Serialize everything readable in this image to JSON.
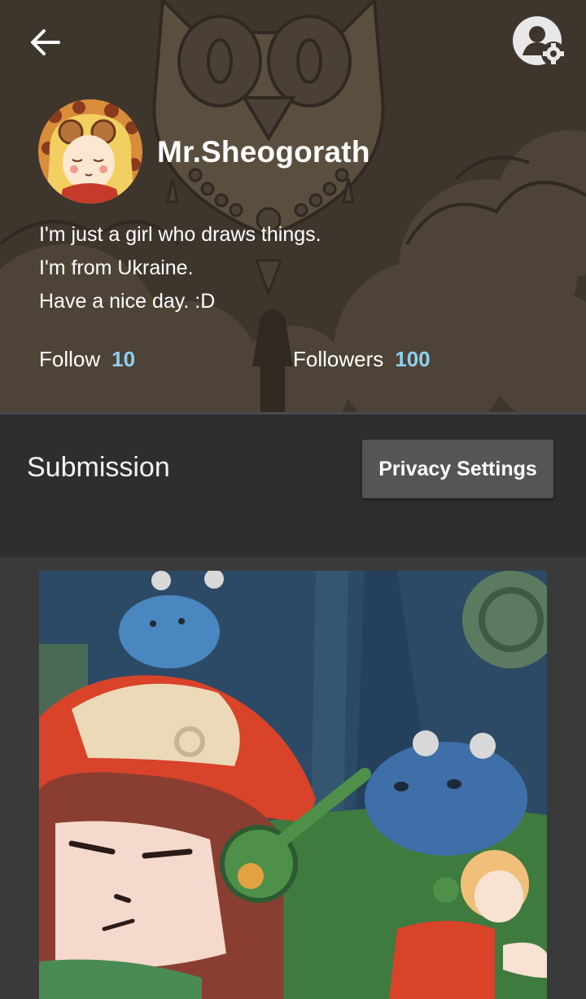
{
  "nav": {
    "back_icon": "back-arrow-icon",
    "settings_icon": "account-settings-icon"
  },
  "profile": {
    "username": "Mr.Sheogorath",
    "bio": [
      "I'm just a girl who draws things.",
      "I'm from Ukraine.",
      "Have a nice day. :D"
    ],
    "follow_label": "Follow",
    "follow_count": "10",
    "followers_label": "Followers",
    "followers_count": "100"
  },
  "submission": {
    "title": "Submission",
    "privacy_button": "Privacy Settings"
  },
  "colors": {
    "header_bg": "#3e362d",
    "accent_count": "#8fd0f2",
    "bar_bg": "#2e2e2e",
    "page_bg": "#3a3a3a",
    "button_bg": "#555555"
  }
}
